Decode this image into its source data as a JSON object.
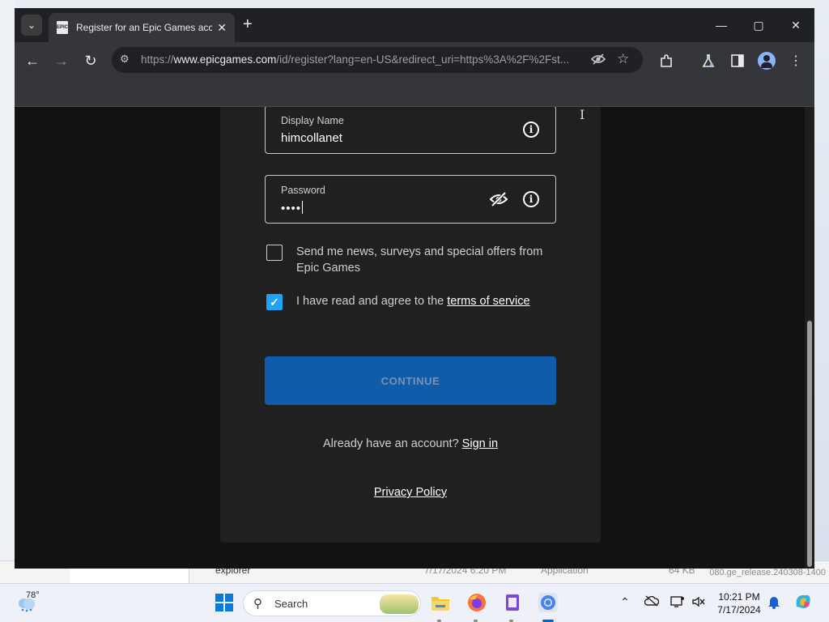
{
  "browser": {
    "tab_title": "Register for an Epic Games account",
    "favicon_text": "EPIC",
    "url_prefix": "https://",
    "url_host": "www.epicgames.com",
    "url_rest": "/id/register?lang=en-US&redirect_uri=https%3A%2F%2Fst..."
  },
  "form": {
    "display_name_label": "Display Name",
    "display_name_value": "himcollanet",
    "password_label": "Password",
    "password_value": "••••",
    "newsletter_label": "Send me news, surveys and special offers from Epic Games",
    "newsletter_checked": false,
    "terms_prefix": "I have read and agree to the ",
    "terms_link": "terms of service",
    "terms_checked": true,
    "continue_label": "CONTINUE",
    "signin_prefix": "Already have an account? ",
    "signin_link": "Sign in",
    "privacy_link": "Privacy Policy"
  },
  "desktop": {
    "file_name": "explorer",
    "file_date": "7/17/2024 6:20 PM",
    "file_type": "Application",
    "file_size": "64 KB",
    "build_text": "080.ge_release.240308-1400"
  },
  "taskbar": {
    "weather_temp": "78°",
    "search_placeholder": "Search",
    "clock_time": "10:21 PM",
    "clock_date": "7/17/2024"
  },
  "colors": {
    "continue_bg": "#0f5cab",
    "checkbox_checked": "#1fa2f7",
    "browser_dark": "#202124"
  }
}
